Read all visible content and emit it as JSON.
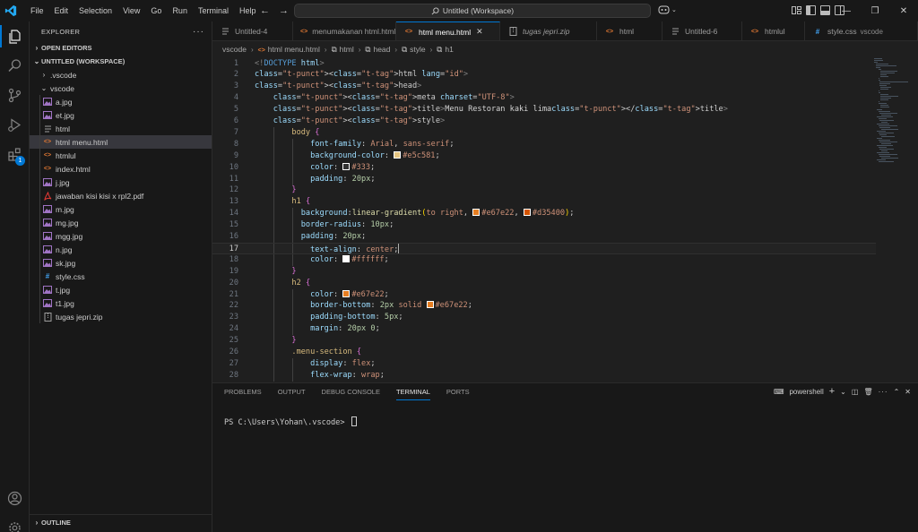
{
  "menu": [
    "File",
    "Edit",
    "Selection",
    "View",
    "Go",
    "Run",
    "Terminal",
    "Help"
  ],
  "command_center": "Untitled (Workspace)",
  "explorer": {
    "title": "EXPLORER",
    "open_editors": "OPEN EDITORS",
    "workspace": "UNTITLED (WORKSPACE)",
    "outline": "OUTLINE",
    "badge_count": "1",
    "items": [
      {
        "label": ".vscode",
        "kind": "folder-closed"
      },
      {
        "label": "vscode",
        "kind": "folder-open"
      },
      {
        "label": "a.jpg",
        "kind": "image"
      },
      {
        "label": "et.jpg",
        "kind": "image"
      },
      {
        "label": "html",
        "kind": "file"
      },
      {
        "label": "html menu.html",
        "kind": "html"
      },
      {
        "label": "htmlul",
        "kind": "html"
      },
      {
        "label": "index.html",
        "kind": "html"
      },
      {
        "label": "j.jpg",
        "kind": "image"
      },
      {
        "label": "jawaban kisi kisi x rpl2.pdf",
        "kind": "pdf"
      },
      {
        "label": "m.jpg",
        "kind": "image"
      },
      {
        "label": "mg.jpg",
        "kind": "image"
      },
      {
        "label": "mgg.jpg",
        "kind": "image"
      },
      {
        "label": "n.jpg",
        "kind": "image"
      },
      {
        "label": "sk.jpg",
        "kind": "image"
      },
      {
        "label": "style.css",
        "kind": "css"
      },
      {
        "label": "t.jpg",
        "kind": "image"
      },
      {
        "label": "t1.jpg",
        "kind": "image"
      },
      {
        "label": "tugas jepri.zip",
        "kind": "zip"
      }
    ]
  },
  "tabs": [
    {
      "label": "Untitled-4",
      "sub": "",
      "kind": "text"
    },
    {
      "label": "menumakanan html.html",
      "sub": "",
      "kind": "html"
    },
    {
      "label": "html menu.html",
      "sub": "",
      "kind": "html"
    },
    {
      "label": "tugas jepri.zip",
      "sub": "",
      "kind": "zip"
    },
    {
      "label": "html",
      "sub": "",
      "kind": "html"
    },
    {
      "label": "Untitled-6",
      "sub": "",
      "kind": "text"
    },
    {
      "label": "htmlul",
      "sub": "",
      "kind": "html"
    },
    {
      "label": "style.css",
      "sub": "vscode",
      "kind": "css"
    }
  ],
  "breadcrumb": [
    "vscode",
    "html menu.html",
    "html",
    "head",
    "style",
    "h1"
  ],
  "code": [
    {
      "n": "1",
      "text": "<!DOCTYPE html>"
    },
    {
      "n": "2",
      "text": "<html lang=\"id\">"
    },
    {
      "n": "3",
      "text": "<head>"
    },
    {
      "n": "4",
      "text": "    <meta charset=\"UTF-8\">"
    },
    {
      "n": "5",
      "text": "    <title>Menu Restoran kaki lima</title>"
    },
    {
      "n": "6",
      "text": "    <style>"
    },
    {
      "n": "7",
      "text": "        body {"
    },
    {
      "n": "8",
      "text": "            font-family: Arial, sans-serif;"
    },
    {
      "n": "9",
      "text": "            background-color: #e5c581;"
    },
    {
      "n": "10",
      "text": "            color: #333;"
    },
    {
      "n": "11",
      "text": "            padding: 20px;"
    },
    {
      "n": "12",
      "text": "        }"
    },
    {
      "n": "13",
      "text": "        h1 {"
    },
    {
      "n": "14",
      "text": "          background:linear-gradient(to right, #e67e22, #d35400);"
    },
    {
      "n": "15",
      "text": "          border-radius: 10px;"
    },
    {
      "n": "16",
      "text": "          padding: 20px;"
    },
    {
      "n": "17",
      "text": "            text-align: center;"
    },
    {
      "n": "18",
      "text": "            color: #ffffff;"
    },
    {
      "n": "19",
      "text": "        }"
    },
    {
      "n": "20",
      "text": "        h2 {"
    },
    {
      "n": "21",
      "text": "            color: #e67e22;"
    },
    {
      "n": "22",
      "text": "            border-bottom: 2px solid #e67e22;"
    },
    {
      "n": "23",
      "text": "            padding-bottom: 5px;"
    },
    {
      "n": "24",
      "text": "            margin: 20px 0;"
    },
    {
      "n": "25",
      "text": "        }"
    },
    {
      "n": "26",
      "text": "        .menu-section {"
    },
    {
      "n": "27",
      "text": "            display: flex;"
    },
    {
      "n": "28",
      "text": "            flex-wrap: wrap;"
    }
  ],
  "panel": {
    "tabs": [
      "PROBLEMS",
      "OUTPUT",
      "DEBUG CONSOLE",
      "TERMINAL",
      "PORTS"
    ],
    "active_tab": "TERMINAL",
    "shell": "powershell",
    "prompt": "PS C:\\Users\\Yohan\\.vscode> "
  },
  "colors": {
    "accent": "#0078d4",
    "swatch_bg": "#e5c581",
    "swatch_333": "#333333",
    "swatch_orange": "#e67e22",
    "swatch_dark_orange": "#d35400",
    "swatch_white": "#ffffff"
  }
}
